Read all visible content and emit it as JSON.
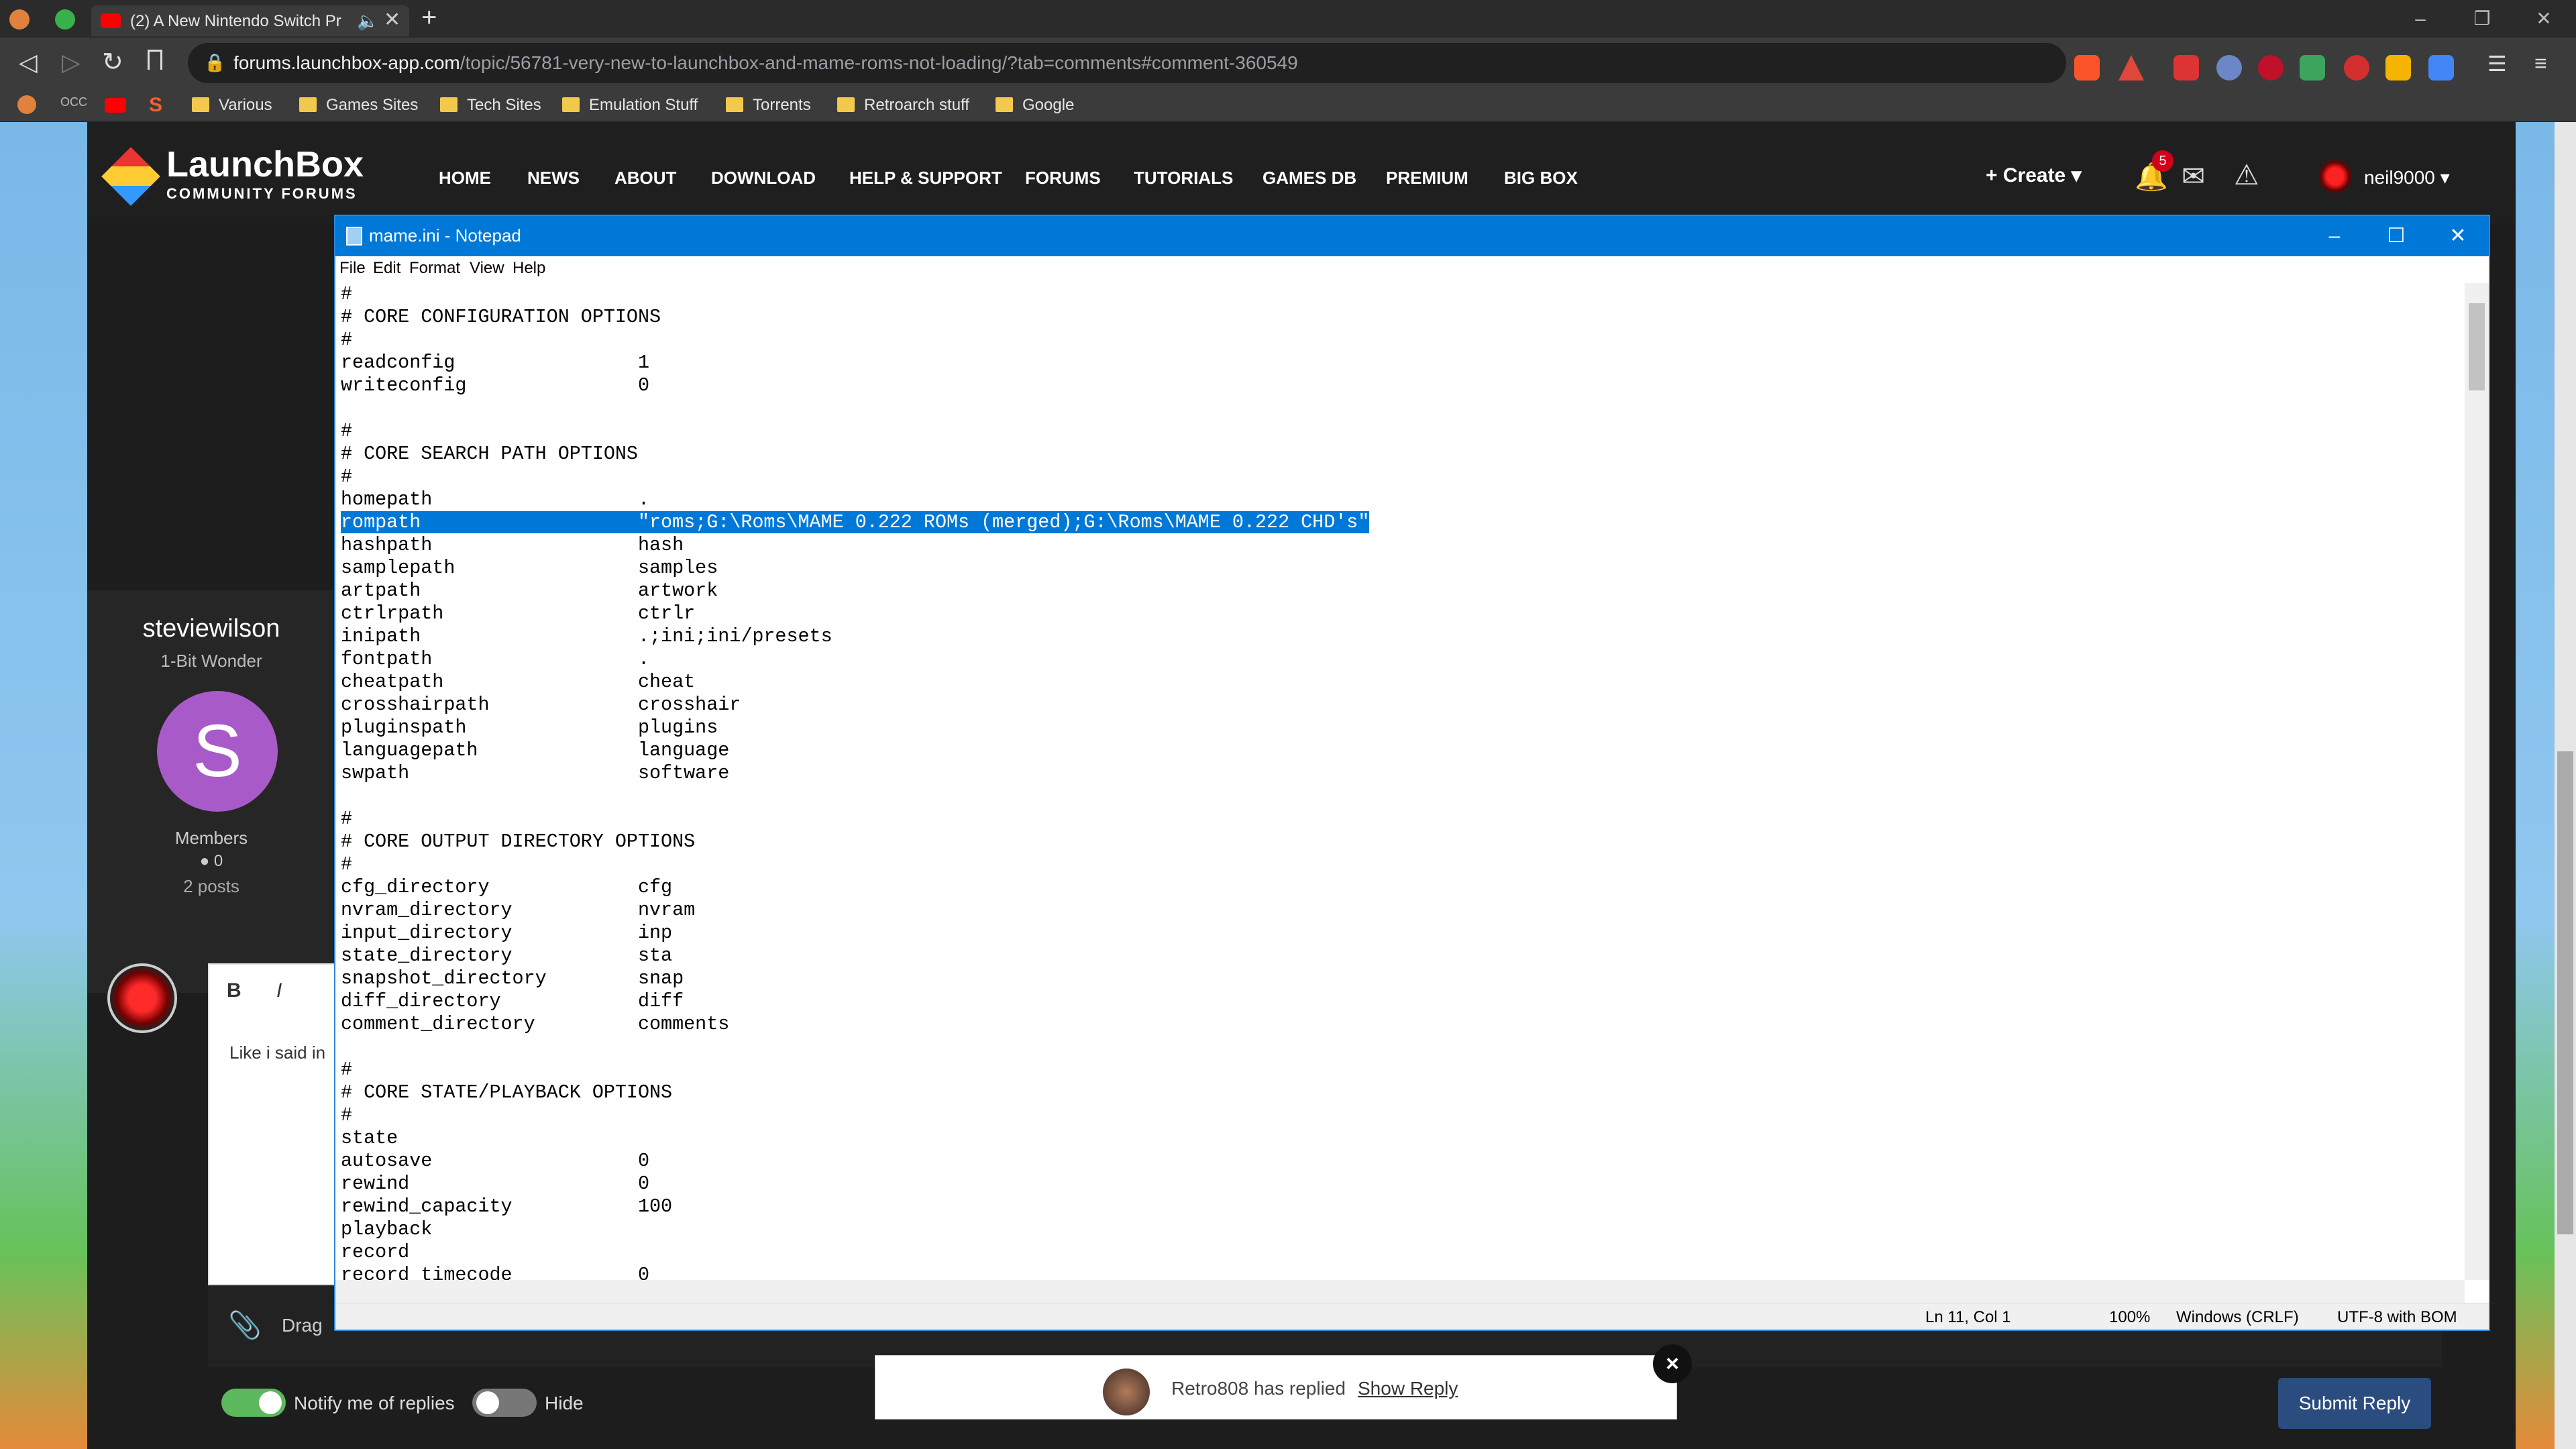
{
  "browser": {
    "tab_title": "(2) A New Nintendo Switch Pr",
    "url_host": "forums.launchbox-app.com",
    "url_path": "/topic/56781-very-new-to-launchbox-and-mame-roms-not-loading/?tab=comments#comment-360549",
    "bookmarks": [
      "Various",
      "Games Sites",
      "Tech Sites",
      "Emulation Stuff",
      "Torrents",
      "Retroarch stuff",
      "Google"
    ]
  },
  "forum": {
    "logo_text": "LaunchBox",
    "logo_sub": "COMMUNITY FORUMS",
    "nav": [
      "HOME",
      "NEWS",
      "ABOUT",
      "DOWNLOAD",
      "HELP & SUPPORT",
      "FORUMS",
      "TUTORIALS",
      "GAMES DB",
      "PREMIUM",
      "BIG BOX"
    ],
    "create": "Create",
    "notif_count": "5",
    "username": "neil9000",
    "author": {
      "name": "steviewilson",
      "title": "1-Bit Wonder",
      "initial": "S",
      "group": "Members",
      "rep": "0",
      "posts": "2 posts"
    },
    "editor_text": "Like i said in",
    "drag_text": "Drag",
    "notify_label": "Notify me of replies",
    "hide_label": "Hide",
    "submit_label": "Submit Reply",
    "toast": {
      "text": "Retro808 has replied",
      "link": "Show Reply"
    }
  },
  "notepad": {
    "title": "mame.ini - Notepad",
    "menu": [
      "File",
      "Edit",
      "Format",
      "View",
      "Help"
    ],
    "lines": [
      [
        "#",
        ""
      ],
      [
        "# CORE CONFIGURATION OPTIONS",
        ""
      ],
      [
        "#",
        ""
      ],
      [
        "readconfig",
        "1"
      ],
      [
        "writeconfig",
        "0"
      ],
      [
        "",
        ""
      ],
      [
        "#",
        ""
      ],
      [
        "# CORE SEARCH PATH OPTIONS",
        ""
      ],
      [
        "#",
        ""
      ],
      [
        "homepath",
        "."
      ],
      [
        "rompath",
        "\"roms;G:\\Roms\\MAME 0.222 ROMs (merged);G:\\Roms\\MAME 0.222 CHD's\""
      ],
      [
        "hashpath",
        "hash"
      ],
      [
        "samplepath",
        "samples"
      ],
      [
        "artpath",
        "artwork"
      ],
      [
        "ctrlrpath",
        "ctrlr"
      ],
      [
        "inipath",
        ".;ini;ini/presets"
      ],
      [
        "fontpath",
        "."
      ],
      [
        "cheatpath",
        "cheat"
      ],
      [
        "crosshairpath",
        "crosshair"
      ],
      [
        "pluginspath",
        "plugins"
      ],
      [
        "languagepath",
        "language"
      ],
      [
        "swpath",
        "software"
      ],
      [
        "",
        ""
      ],
      [
        "#",
        ""
      ],
      [
        "# CORE OUTPUT DIRECTORY OPTIONS",
        ""
      ],
      [
        "#",
        ""
      ],
      [
        "cfg_directory",
        "cfg"
      ],
      [
        "nvram_directory",
        "nvram"
      ],
      [
        "input_directory",
        "inp"
      ],
      [
        "state_directory",
        "sta"
      ],
      [
        "snapshot_directory",
        "snap"
      ],
      [
        "diff_directory",
        "diff"
      ],
      [
        "comment_directory",
        "comments"
      ],
      [
        "",
        ""
      ],
      [
        "#",
        ""
      ],
      [
        "# CORE STATE/PLAYBACK OPTIONS",
        ""
      ],
      [
        "#",
        ""
      ],
      [
        "state",
        ""
      ],
      [
        "autosave",
        "0"
      ],
      [
        "rewind",
        "0"
      ],
      [
        "rewind_capacity",
        "100"
      ],
      [
        "playback",
        ""
      ],
      [
        "record",
        ""
      ],
      [
        "record_timecode",
        "0"
      ]
    ],
    "selected_line": 10,
    "status": {
      "position": "Ln 11, Col 1",
      "zoom": "100%",
      "eol": "Windows (CRLF)",
      "encoding": "UTF-8 with BOM"
    }
  }
}
